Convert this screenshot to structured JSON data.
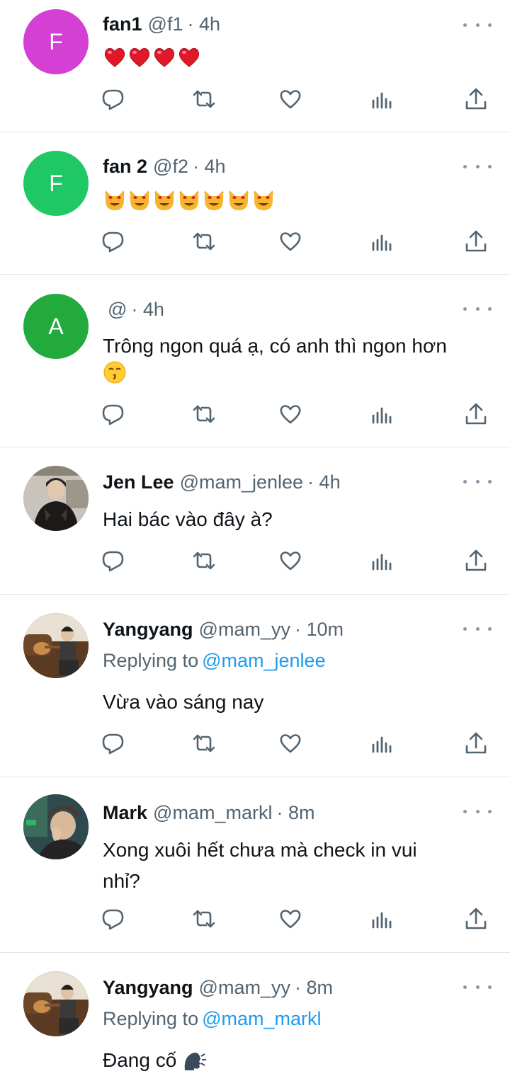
{
  "tweets": [
    {
      "name": "fan1",
      "handle": "@f1",
      "time": "· 4h",
      "avatar_letter": "F",
      "avatar_color": "#d43fd4",
      "emoji_name": "red-heart",
      "emoji_count": 4
    },
    {
      "name": "fan 2",
      "handle": "@f2",
      "time": "· 4h",
      "avatar_letter": "F",
      "avatar_color": "#1fc864",
      "emoji_name": "smiling-cat-heart-eyes",
      "emoji_count": 7
    },
    {
      "name": "",
      "handle": "@",
      "time": "· 4h",
      "avatar_letter": "A",
      "avatar_color": "#22aa3c",
      "text_line1": "Trông ngon quá ạ, có anh thì ngon hơn",
      "emoji_name": "kissing-face"
    },
    {
      "name": "Jen Lee",
      "handle": "@mam_jenlee",
      "time": "· 4h",
      "avatar_photo": "person-in-leather-jacket",
      "text": "Hai bác vào đây à?"
    },
    {
      "name": "Yangyang",
      "handle": "@mam_yy",
      "time": "· 10m",
      "avatar_photo": "person-on-sofa-with-guitar",
      "replying_label": "Replying to",
      "replying_handle": "@mam_jenlee",
      "text": "Vừa vào sáng nay"
    },
    {
      "name": "Mark",
      "handle": "@mam_markl",
      "time": "· 8m",
      "avatar_photo": "person-with-hand-on-face",
      "text_line1": "Xong xuôi hết chưa mà check in vui",
      "text_line2": "nhỉ?"
    },
    {
      "name": "Yangyang",
      "handle": "@mam_yy",
      "time": "· 8m",
      "avatar_photo": "person-on-sofa-with-guitar",
      "replying_label": "Replying to",
      "replying_handle": "@mam_markl",
      "text": "Đang cố",
      "emoji_name": "speaking-head"
    }
  ],
  "action_icons": [
    "reply-icon",
    "retweet-icon",
    "like-icon",
    "views-icon",
    "share-icon"
  ],
  "colors": {
    "text": "#0f1419",
    "muted": "#536471",
    "link": "#1d9bf0",
    "icon": "#536471",
    "divider": "#e1e6ea",
    "heart_emoji": "#e0182a",
    "cat_emoji": "#f5a623"
  }
}
